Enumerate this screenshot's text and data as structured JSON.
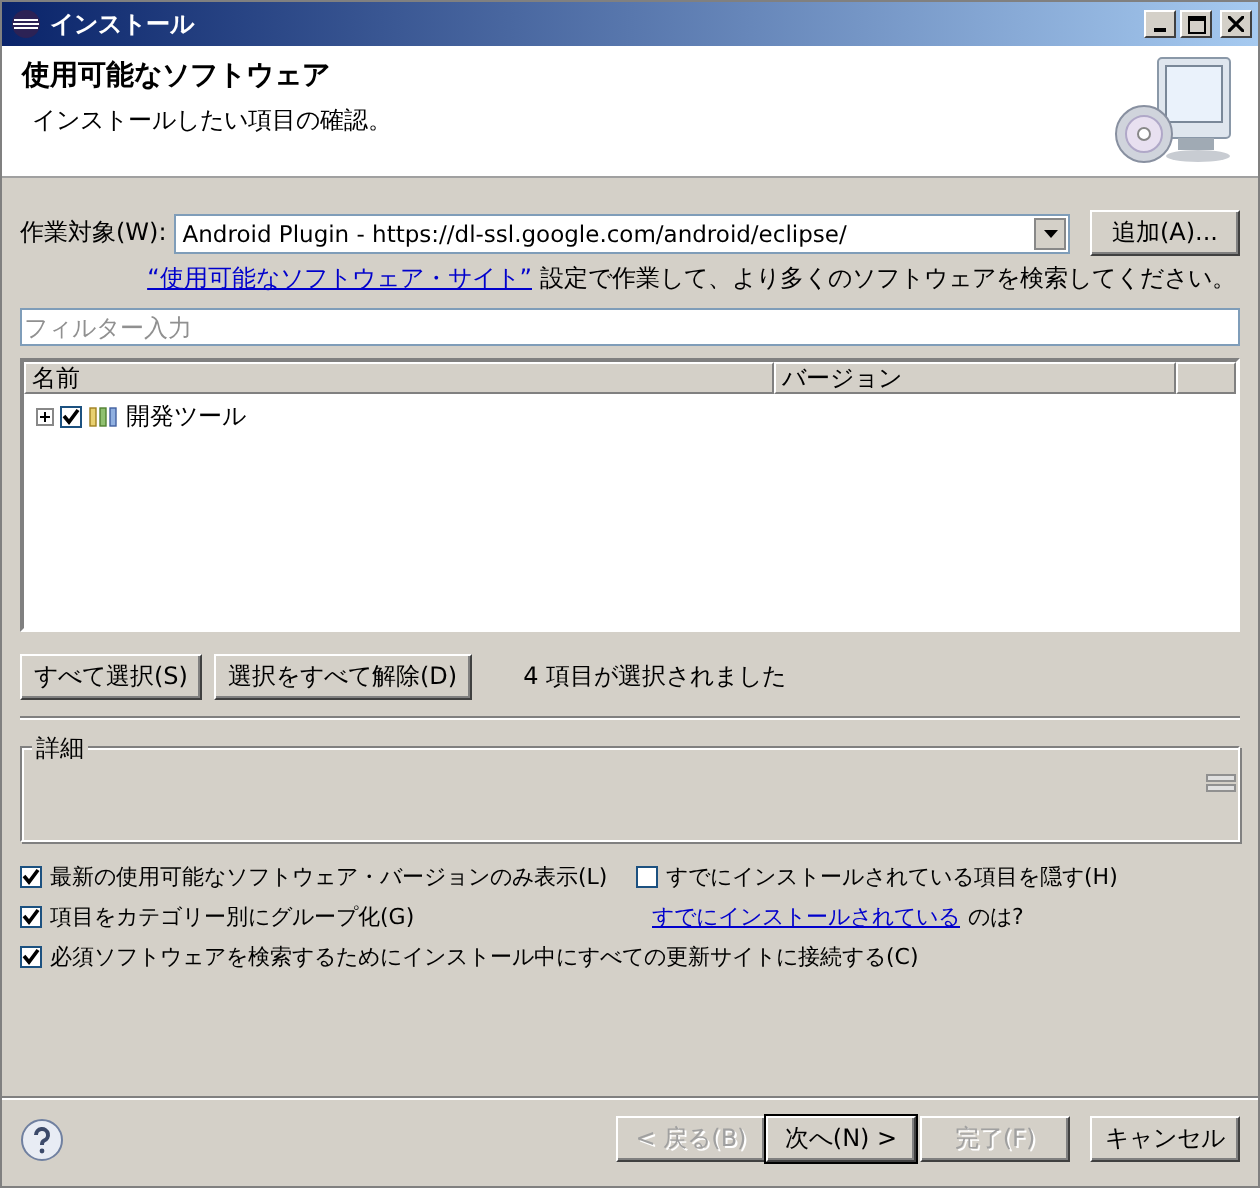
{
  "window": {
    "title": "インストール"
  },
  "header": {
    "title": "使用可能なソフトウェア",
    "subtitle": "インストールしたい項目の確認。"
  },
  "work_with": {
    "label": "作業対象(W):",
    "value": "Android Plugin - https://dl-ssl.google.com/android/eclipse/",
    "add_button": "追加(A)..."
  },
  "site_hint": {
    "link": "“使用可能なソフトウェア・サイト”",
    "text": "設定で作業して、より多くのソフトウェアを検索してください。"
  },
  "filter": {
    "placeholder": "フィルター入力"
  },
  "table": {
    "columns": [
      "名前",
      "バージョン"
    ],
    "rows": [
      {
        "name": "開発ツール",
        "expanded": false,
        "checked": true
      }
    ]
  },
  "selection": {
    "buttons": [
      "すべて選択(S)",
      "選択をすべて解除(D)"
    ],
    "status": "4 項目が選択されました"
  },
  "details": {
    "label": "詳細"
  },
  "options": [
    {
      "kind": "checkbox",
      "label": "最新の使用可能なソフトウェア・バージョンのみ表示(L)",
      "checked": true
    },
    {
      "kind": "checkbox",
      "label": "すでにインストールされている項目を隠す(H)",
      "checked": false
    },
    {
      "kind": "checkbox",
      "label": "項目をカテゴリー別にグループ化(G)",
      "checked": true
    },
    {
      "kind": "link",
      "link": "すでにインストールされている",
      "text": "のは?"
    },
    {
      "kind": "checkbox",
      "label": "必須ソフトウェアを検索するためにインストール中にすべての更新サイトに接続する(C)",
      "checked": true
    }
  ],
  "footer": {
    "buttons": [
      {
        "label": "< 戻る(B)",
        "disabled": true,
        "default": false
      },
      {
        "label": "次へ(N) >",
        "disabled": false,
        "default": true
      },
      {
        "label": "完了(F)",
        "disabled": true,
        "default": false
      },
      {
        "label": "キャンセル",
        "disabled": false,
        "default": false
      }
    ]
  }
}
